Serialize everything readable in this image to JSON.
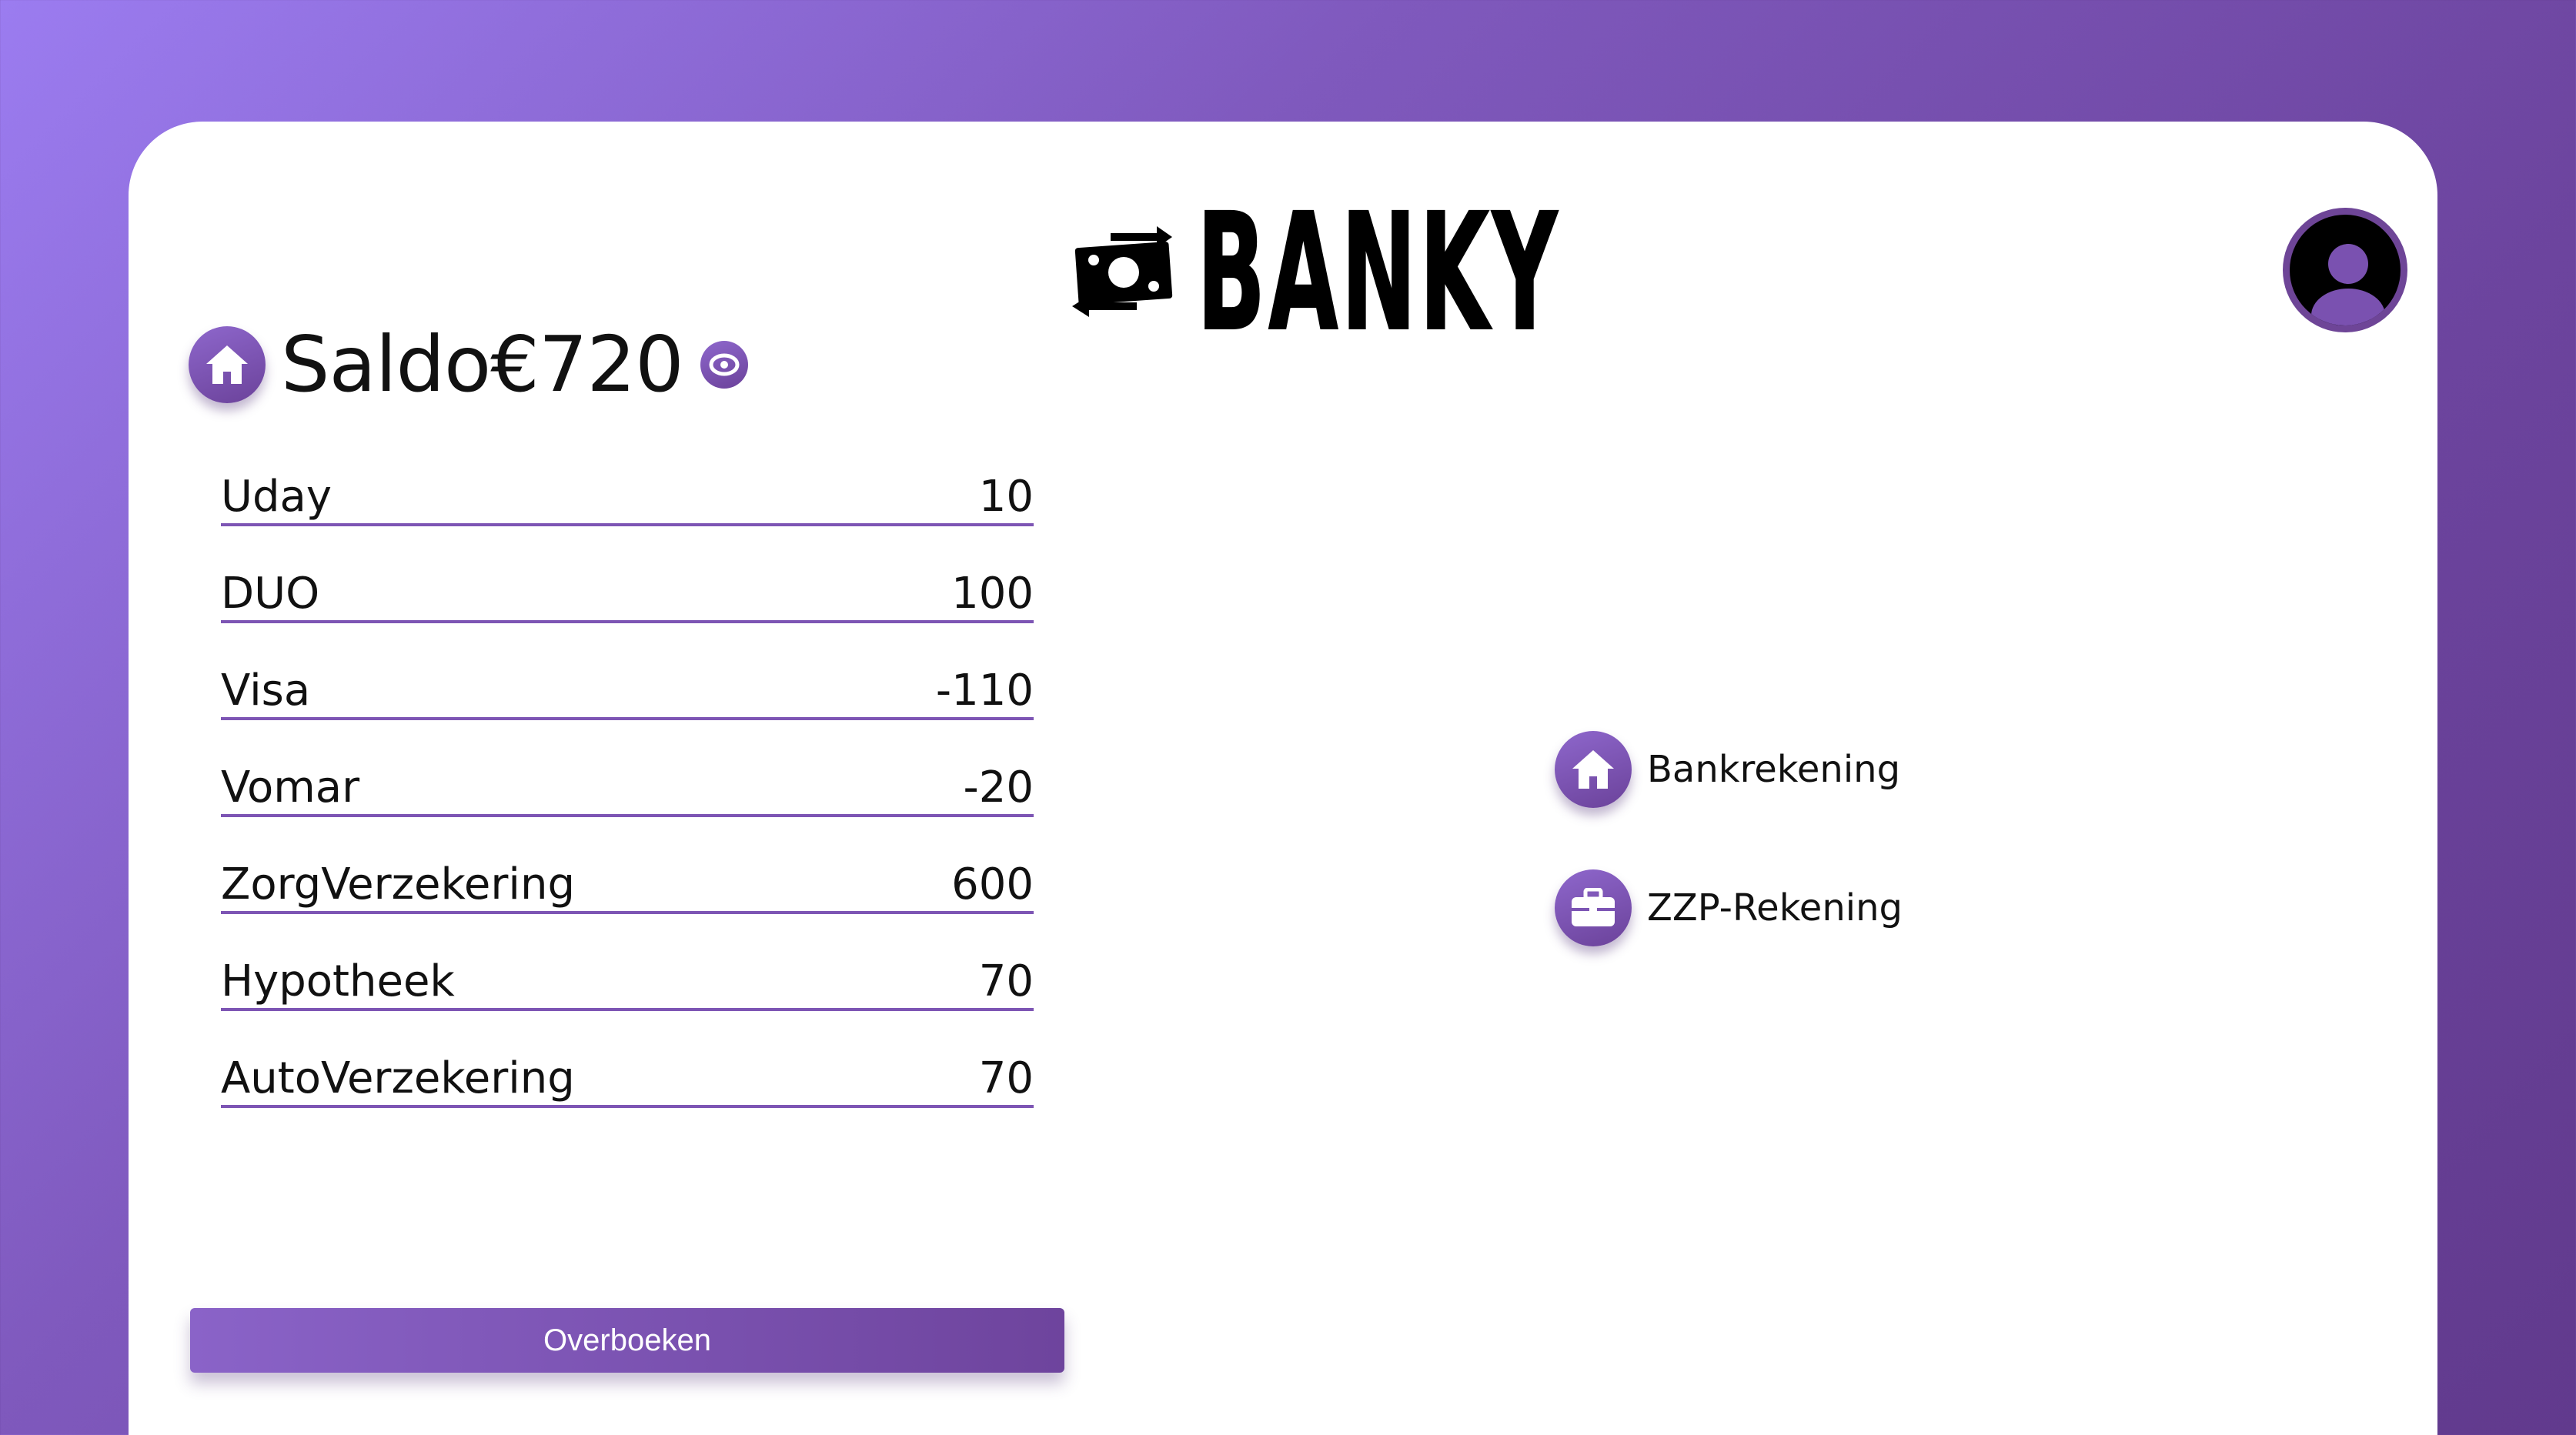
{
  "brand": {
    "name": "BANKY",
    "logo_icon": "money-transfer-icon"
  },
  "user": {
    "avatar_icon": "user-avatar-icon"
  },
  "balance": {
    "icon": "home-icon",
    "text": "Saldo€720",
    "visibility_icon": "eye-icon"
  },
  "transactions": [
    {
      "name": "Uday",
      "amount": "10"
    },
    {
      "name": "DUO",
      "amount": "100"
    },
    {
      "name": "Visa",
      "amount": "-110"
    },
    {
      "name": "Vomar",
      "amount": "-20"
    },
    {
      "name": "ZorgVerzekering",
      "amount": "600"
    },
    {
      "name": "Hypotheek",
      "amount": "70"
    },
    {
      "name": "AutoVerzekering",
      "amount": "70"
    }
  ],
  "actions": {
    "transfer_label": "Overboeken"
  },
  "accounts": [
    {
      "label": "Bankrekening",
      "icon": "home-icon"
    },
    {
      "label": "ZZP-Rekening",
      "icon": "briefcase-icon"
    }
  ],
  "colors": {
    "accent": "#7d55b4",
    "background_start": "#9b7cf0",
    "background_end": "#613a8d"
  }
}
